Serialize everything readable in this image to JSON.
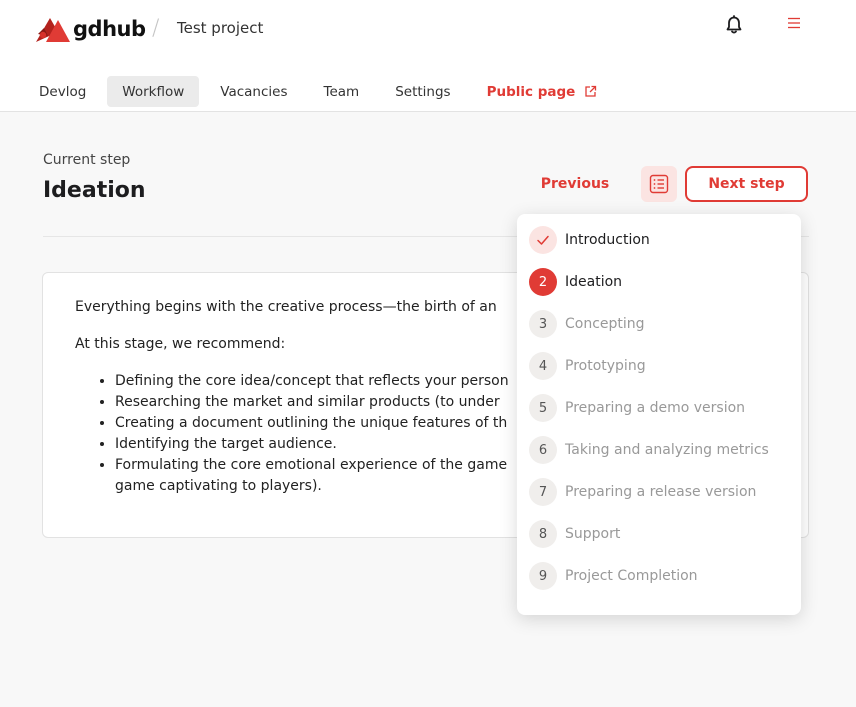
{
  "header": {
    "logo_text": "gdhub",
    "separator": "/",
    "project_name": "Test project"
  },
  "tabs": [
    {
      "label": "Devlog",
      "active": false
    },
    {
      "label": "Workflow",
      "active": true
    },
    {
      "label": "Vacancies",
      "active": false
    },
    {
      "label": "Team",
      "active": false
    },
    {
      "label": "Settings",
      "active": false
    },
    {
      "label": "Public page",
      "active": false
    }
  ],
  "step": {
    "current_label": "Current step",
    "title": "Ideation"
  },
  "actions": {
    "previous": "Previous",
    "next": "Next step"
  },
  "content": {
    "intro": "Everything begins with the creative process—the birth of an",
    "recommend": "At this stage, we recommend:",
    "bullets": [
      "Defining the core idea/concept that reflects your person",
      "Researching the market and similar products (to under",
      "Creating a document outlining the unique features of th",
      "Identifying the target audience.",
      "Formulating the core emotional experience of the game",
      "game captivating to players)."
    ]
  },
  "steps_menu": [
    {
      "number": "",
      "label": "Introduction",
      "state": "done"
    },
    {
      "number": "2",
      "label": "Ideation",
      "state": "current"
    },
    {
      "number": "3",
      "label": "Concepting",
      "state": "upcoming"
    },
    {
      "number": "4",
      "label": "Prototyping",
      "state": "upcoming"
    },
    {
      "number": "5",
      "label": "Preparing a demo version",
      "state": "upcoming"
    },
    {
      "number": "6",
      "label": "Taking and analyzing metrics",
      "state": "upcoming"
    },
    {
      "number": "7",
      "label": "Preparing a release version",
      "state": "upcoming"
    },
    {
      "number": "8",
      "label": "Support",
      "state": "upcoming"
    },
    {
      "number": "9",
      "label": "Project Completion",
      "state": "upcoming"
    }
  ],
  "icons": {
    "logo": "gdhub-logo-icon",
    "bell": "bell-icon",
    "menu": "hamburger-menu-icon",
    "external": "external-link-icon",
    "steps_list": "list-icon",
    "check": "check-icon"
  },
  "colors": {
    "accent": "#e03b35",
    "accent_light": "#fbe4e2",
    "background": "#f8f8f8"
  }
}
